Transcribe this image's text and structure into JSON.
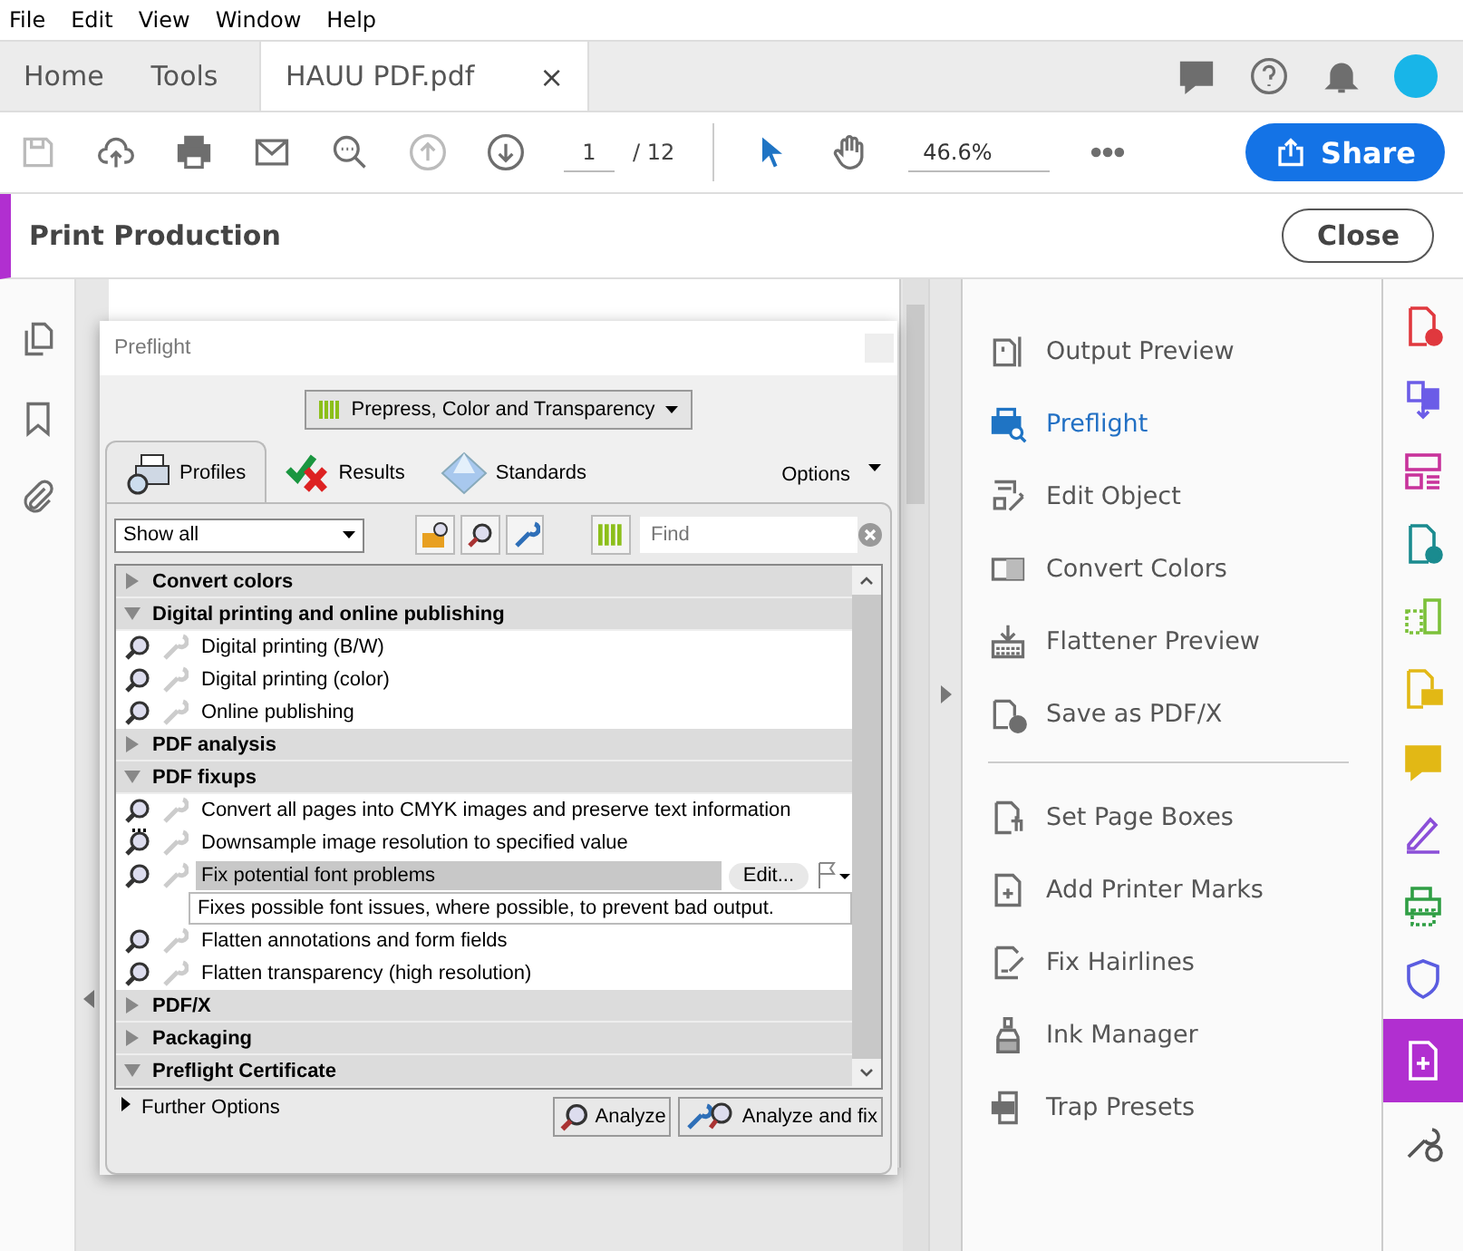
{
  "menu": [
    "File",
    "Edit",
    "View",
    "Window",
    "Help"
  ],
  "tabs": [
    {
      "label": "Home",
      "selected": false
    },
    {
      "label": "Tools",
      "selected": false
    },
    {
      "label": "HAUU PDF.pdf",
      "selected": true,
      "close": "×"
    }
  ],
  "toolbar": {
    "page": "1",
    "page_total": "/ 12",
    "zoom": "46.6%",
    "share": "Share"
  },
  "panel": {
    "title": "Print Production",
    "close": "Close"
  },
  "preflight": {
    "title": "Preflight",
    "profile_set": "Prepress, Color and Transparency",
    "tabs": [
      {
        "label": "Profiles",
        "selected": true
      },
      {
        "label": "Results",
        "selected": false
      },
      {
        "label": "Standards",
        "selected": false
      }
    ],
    "options": "Options",
    "filter": "Show all",
    "find_placeholder": "Find",
    "groups": [
      {
        "label": "Convert colors",
        "expanded": false
      },
      {
        "label": "Digital printing and online publishing",
        "expanded": true,
        "items": [
          {
            "label": "Digital printing (B/W)",
            "kind": "plain",
            "selected": false
          },
          {
            "label": "Digital printing (color)",
            "kind": "plain",
            "selected": false
          },
          {
            "label": "Online publishing",
            "kind": "plain",
            "selected": false
          }
        ]
      },
      {
        "label": "PDF analysis",
        "expanded": false
      },
      {
        "label": "PDF fixups",
        "expanded": true,
        "items": [
          {
            "label": "Convert all pages into CMYK images and preserve text information",
            "kind": "plain",
            "selected": false
          },
          {
            "label": "Downsample image resolution to specified value",
            "kind": "dotted",
            "selected": false
          },
          {
            "label": "Fix potential font problems",
            "kind": "plain",
            "selected": true,
            "edit": "Edit...",
            "description": "Fixes possible font issues, where possible, to prevent bad output."
          },
          {
            "label": "Flatten annotations and form fields",
            "kind": "plain",
            "selected": false
          },
          {
            "label": "Flatten transparency (high resolution)",
            "kind": "plain",
            "selected": false
          }
        ]
      },
      {
        "label": "PDF/X",
        "expanded": false
      },
      {
        "label": "Packaging",
        "expanded": false
      },
      {
        "label": "Preflight Certificate",
        "expanded": true
      }
    ],
    "further": "Further Options",
    "analyze": "Analyze",
    "analyze_fix": "Analyze and fix"
  },
  "tools": [
    [
      {
        "label": "Output Preview",
        "kind": "output",
        "selected": false
      },
      {
        "label": "Preflight",
        "kind": "preflight",
        "selected": true
      },
      {
        "label": "Edit Object",
        "kind": "edit",
        "selected": false
      },
      {
        "label": "Convert Colors",
        "kind": "convert",
        "selected": false
      },
      {
        "label": "Flattener Preview",
        "kind": "flatten",
        "selected": false
      },
      {
        "label": "Save as PDF/X",
        "kind": "pdfx",
        "selected": false
      }
    ],
    [
      {
        "label": "Set Page Boxes",
        "kind": "boxes",
        "selected": false
      },
      {
        "label": "Add Printer Marks",
        "kind": "marks",
        "selected": false
      },
      {
        "label": "Fix Hairlines",
        "kind": "hairlines",
        "selected": false
      },
      {
        "label": "Ink Manager",
        "kind": "ink",
        "selected": false
      },
      {
        "label": "Trap Presets",
        "kind": "trap",
        "selected": false
      }
    ]
  ],
  "rail": [
    {
      "kind": "create",
      "color": "#e0383e",
      "selected": false
    },
    {
      "kind": "combine",
      "color": "#6b5ce7",
      "selected": false
    },
    {
      "kind": "organize",
      "color": "#c8339b",
      "selected": false
    },
    {
      "kind": "export",
      "color": "#1a8b8f",
      "selected": false
    },
    {
      "kind": "pages",
      "color": "#7cc13a",
      "selected": false
    },
    {
      "kind": "comment-doc",
      "color": "#e2b815",
      "selected": false
    },
    {
      "kind": "comment",
      "color": "#e2b815",
      "selected": false
    },
    {
      "kind": "sign",
      "color": "#8b4fd8",
      "selected": false
    },
    {
      "kind": "print",
      "color": "#2f9e44",
      "selected": false
    },
    {
      "kind": "protect",
      "color": "#5a5ce0",
      "selected": false
    },
    {
      "kind": "production",
      "color": "#b12fd0",
      "selected": true
    },
    {
      "kind": "more",
      "color": "#555555",
      "selected": false
    }
  ]
}
